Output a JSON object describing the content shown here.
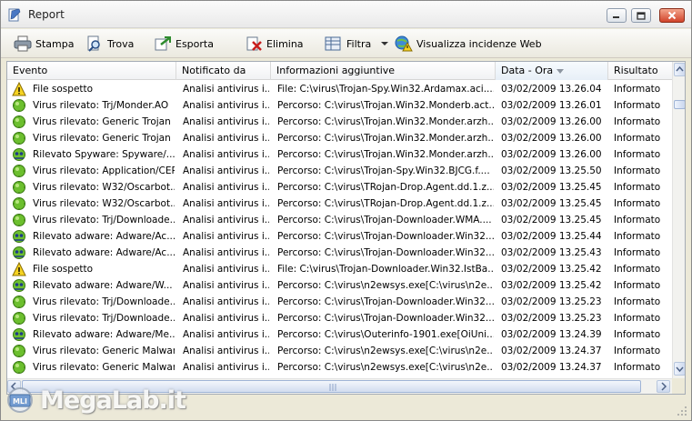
{
  "window": {
    "title": "Report"
  },
  "toolbar": {
    "stampa": "Stampa",
    "trova": "Trova",
    "esporta": "Esporta",
    "elimina": "Elimina",
    "filtra": "Filtra",
    "visualizza": "Visualizza incidenze Web"
  },
  "columns": [
    "Evento",
    "Notificato da",
    "Informazioni aggiuntive",
    "Data - Ora",
    "Risultato"
  ],
  "rows": [
    {
      "icon": "warning",
      "evento": "File sospetto",
      "notificato": "Analisi antivirus i...",
      "info": "File: C:\\virus\\Trojan-Spy.Win32.Ardamax.aci....",
      "data": "03/02/2009 13.26.04",
      "risultato": "Informato"
    },
    {
      "icon": "virus",
      "evento": "Virus rilevato: Trj/Monder.AO",
      "notificato": "Analisi antivirus i...",
      "info": "Percorso: C:\\virus\\Trojan.Win32.Monderb.act...",
      "data": "03/02/2009 13.26.01",
      "risultato": "Informato"
    },
    {
      "icon": "virus",
      "evento": "Virus rilevato: Generic Trojan",
      "notificato": "Analisi antivirus i...",
      "info": "Percorso: C:\\virus\\Trojan.Win32.Monder.arzh...",
      "data": "03/02/2009 13.26.00",
      "risultato": "Informato"
    },
    {
      "icon": "virus",
      "evento": "Virus rilevato: Generic Trojan",
      "notificato": "Analisi antivirus i...",
      "info": "Percorso: C:\\virus\\Trojan.Win32.Monder.arzh...",
      "data": "03/02/2009 13.26.00",
      "risultato": "Informato"
    },
    {
      "icon": "spyware",
      "evento": "Rilevato Spyware: Spyware/...",
      "notificato": "Analisi antivirus i...",
      "info": "Percorso: C:\\virus\\Trojan.Win32.Monder.arzh...",
      "data": "03/02/2009 13.26.00",
      "risultato": "Informato"
    },
    {
      "icon": "virus",
      "evento": "Virus rilevato: Application/CEPD",
      "notificato": "Analisi antivirus i...",
      "info": "Percorso: C:\\virus\\Trojan-Spy.Win32.BJCG.f....",
      "data": "03/02/2009 13.25.50",
      "risultato": "Informato"
    },
    {
      "icon": "virus",
      "evento": "Virus rilevato: W32/Oscarbot...",
      "notificato": "Analisi antivirus i...",
      "info": "Percorso: C:\\virus\\TRojan-Drop.Agent.dd.1.z...",
      "data": "03/02/2009 13.25.45",
      "risultato": "Informato"
    },
    {
      "icon": "virus",
      "evento": "Virus rilevato: W32/Oscarbot...",
      "notificato": "Analisi antivirus i...",
      "info": "Percorso: C:\\virus\\TRojan-Drop.Agent.dd.1.z...",
      "data": "03/02/2009 13.25.45",
      "risultato": "Informato"
    },
    {
      "icon": "virus",
      "evento": "Virus rilevato: Trj/Downloade...",
      "notificato": "Analisi antivirus i...",
      "info": "Percorso: C:\\virus\\Trojan-Downloader.WMA....",
      "data": "03/02/2009 13.25.45",
      "risultato": "Informato"
    },
    {
      "icon": "spyware",
      "evento": "Rilevato adware: Adware/Ac...",
      "notificato": "Analisi antivirus i...",
      "info": "Percorso: C:\\virus\\Trojan-Downloader.Win32....",
      "data": "03/02/2009 13.25.44",
      "risultato": "Informato"
    },
    {
      "icon": "spyware",
      "evento": "Rilevato adware: Adware/Ac...",
      "notificato": "Analisi antivirus i...",
      "info": "Percorso: C:\\virus\\Trojan-Downloader.Win32....",
      "data": "03/02/2009 13.25.43",
      "risultato": "Informato"
    },
    {
      "icon": "warning",
      "evento": "File sospetto",
      "notificato": "Analisi antivirus i...",
      "info": "File: C:\\virus\\Trojan-Downloader.Win32.IstBa...",
      "data": "03/02/2009 13.25.42",
      "risultato": "Informato"
    },
    {
      "icon": "spyware",
      "evento": "Rilevato adware: Adware/W...",
      "notificato": "Analisi antivirus i...",
      "info": "Percorso: C:\\virus\\n2ewsys.exe[C:\\virus\\n2e...",
      "data": "03/02/2009 13.25.42",
      "risultato": "Informato"
    },
    {
      "icon": "virus",
      "evento": "Virus rilevato: Trj/Downloade...",
      "notificato": "Analisi antivirus i...",
      "info": "Percorso: C:\\virus\\Trojan-Downloader.Win32....",
      "data": "03/02/2009 13.25.23",
      "risultato": "Informato"
    },
    {
      "icon": "virus",
      "evento": "Virus rilevato: Trj/Downloade...",
      "notificato": "Analisi antivirus i...",
      "info": "Percorso: C:\\virus\\Trojan-Downloader.Win32....",
      "data": "03/02/2009 13.25.23",
      "risultato": "Informato"
    },
    {
      "icon": "spyware",
      "evento": "Rilevato adware: Adware/Me...",
      "notificato": "Analisi antivirus i...",
      "info": "Percorso: C:\\virus\\Outerinfo-1901.exe[OiUni...",
      "data": "03/02/2009 13.24.39",
      "risultato": "Informato"
    },
    {
      "icon": "virus",
      "evento": "Virus rilevato: Generic Malware",
      "notificato": "Analisi antivirus i...",
      "info": "Percorso: C:\\virus\\n2ewsys.exe[C:\\virus\\n2e...",
      "data": "03/02/2009 13.24.37",
      "risultato": "Informato"
    },
    {
      "icon": "virus",
      "evento": "Virus rilevato: Generic Malware",
      "notificato": "Analisi antivirus i...",
      "info": "Percorso: C:\\virus\\n2ewsys.exe[C:\\virus\\n2e...",
      "data": "03/02/2009 13.24.37",
      "risultato": "Informato"
    }
  ],
  "watermark": {
    "text": "MegaLab.it"
  }
}
